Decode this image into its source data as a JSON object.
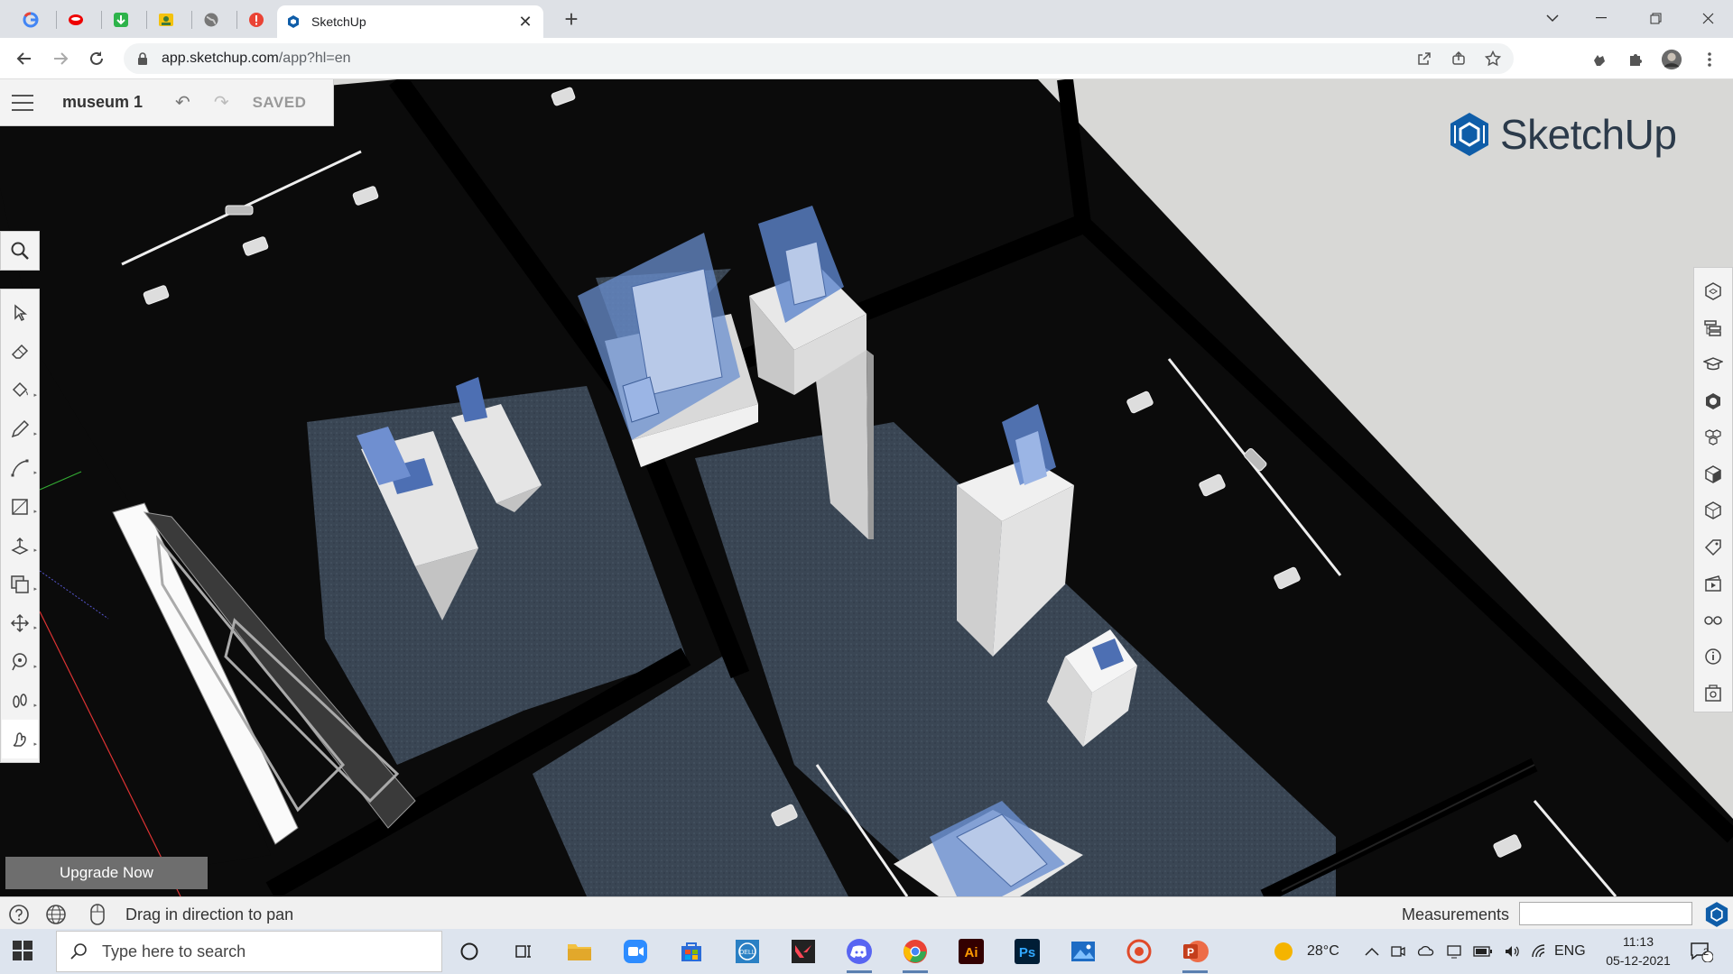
{
  "browser": {
    "tab_title": "SketchUp",
    "url_host": "app.sketchup.com",
    "url_path": "/app?hl=en",
    "close_tab": "✕",
    "new_tab": "+"
  },
  "sketchup": {
    "doc_name": "museum 1",
    "save_state": "SAVED",
    "brand": "SketchUp",
    "upgrade_label": "Upgrade Now",
    "status_hint": "Drag in direction to pan",
    "measurements_label": "Measurements",
    "measurements_value": "",
    "left_tools": [
      "select-icon",
      "eraser-icon",
      "paint-bucket-icon",
      "pencil-line-icon",
      "arc-icon",
      "rectangle-icon",
      "push-pull-icon",
      "offset-icon",
      "move-icon",
      "tape-measure-icon",
      "walk-icon",
      "pan-icon"
    ],
    "right_panels": [
      "entity-info-icon",
      "outliner-icon",
      "instructor-icon",
      "materials-icon",
      "components-icon",
      "styles-icon",
      "scenes-3d-icon",
      "tags-icon",
      "animation-icon",
      "display-icon",
      "model-info-icon",
      "solar-icon"
    ]
  },
  "taskbar": {
    "search_placeholder": "Type here to search",
    "weather": "28°C",
    "language": "ENG",
    "time": "11:13",
    "date": "05-12-2021",
    "notifications": "2",
    "ai_label": "Ai",
    "ps_label": "Ps"
  },
  "colors": {
    "accent": "#1a73e8",
    "sketchup_blue": "#0f5da8",
    "wall": "#0b0b0b",
    "floor": "#3a4654",
    "glass": "#7aa0dd"
  }
}
